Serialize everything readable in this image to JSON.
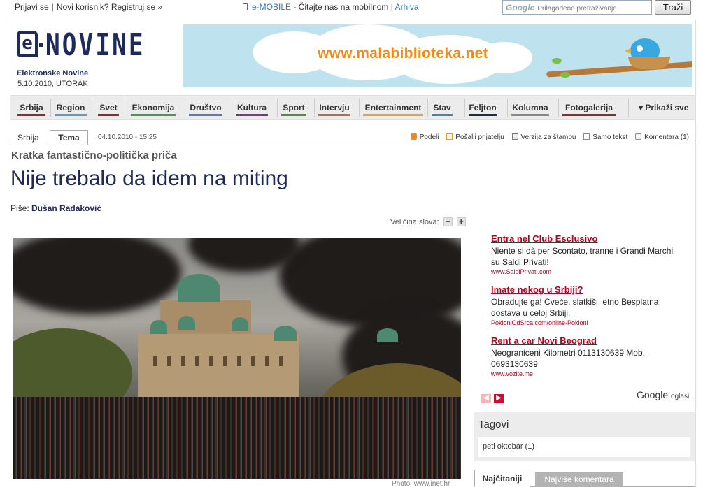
{
  "topbar": {
    "login": "Prijavi se",
    "sep": "|",
    "register": "Novi korisnik? Registruj se »",
    "emobile": "e-MOBILE",
    "emobile_text": " - Čitajte nas na mobilnom | ",
    "archive": "Arhiva",
    "search_logo": "Google",
    "search_placeholder": "Prilagođeno pretraživanje",
    "search_button": "Traži"
  },
  "header": {
    "logo_e": "e",
    "logo_name": "NOVINE",
    "tagline": "Elektronske Novine",
    "date": "5.10.2010, UTORAK",
    "banner_url": "www.malabiblioteka.net"
  },
  "nav": {
    "items": [
      {
        "label": "Srbija",
        "color": "#c8102e"
      },
      {
        "label": "Region",
        "color": "#4a9fd8"
      },
      {
        "label": "Svet",
        "color": "#c8102e"
      },
      {
        "label": "Ekonomija",
        "color": "#3aa23a"
      },
      {
        "label": "Društvo",
        "color": "#4a7fc8"
      },
      {
        "label": "Kultura",
        "color": "#8a2a9a"
      },
      {
        "label": "Sport",
        "color": "#3a9a2a"
      },
      {
        "label": "Intervju",
        "color": "#d0603a"
      },
      {
        "label": "Entertainment",
        "color": "#f0a020"
      },
      {
        "label": "Stav",
        "color": "#2a8ad8"
      },
      {
        "label": "Feljton",
        "color": "#1e2a5a"
      },
      {
        "label": "Kolumna",
        "color": "#888888"
      },
      {
        "label": "Fotogalerija",
        "color": "#c8102e"
      }
    ],
    "more": "Prikaži sve"
  },
  "article": {
    "tab_section": "Srbija",
    "tab_active": "Tema",
    "date": "04.10.2010 - 15:25",
    "tools": {
      "share": "Podeli",
      "send": "Pošalji prijatelju",
      "print": "Verzija za štampu",
      "text_only": "Samo tekst",
      "comments": "Komentara (1)"
    },
    "supertitle": "Kratka fantastično-politička priča",
    "title": "Nije trebalo da idem na miting",
    "author_label": "Piše: ",
    "author": "Dušan Radaković",
    "font_size_label": "Veličina slova:",
    "font_minus": "−",
    "font_plus": "+",
    "photo_caption": "Photo: www.inet.hr"
  },
  "ads": [
    {
      "title": "Entra nel Club Esclusivo",
      "body": "Niente si dà per Scontato, tranne i Grandi Marchi su Saldi Privati!",
      "url": "www.SaldiPrivati.com"
    },
    {
      "title": "Imate nekog u Srbiji?",
      "body": "Obradujte ga! Cveće, slatkiši, etno Besplatna dostava u celoj Srbiji.",
      "url": "PokloniOdSrca.com/online-Pokloni"
    },
    {
      "title": "Rent a car Novi Beograd",
      "body": "Neograniceni Kilometri 0113130639 Mob. 0693130639",
      "url": "www.vozite.me"
    }
  ],
  "ads_footer": {
    "google": "Google",
    "label": "oglasi"
  },
  "tags": {
    "title": "Tagovi",
    "items": [
      "peti oktobar (1)"
    ]
  },
  "bottom_tabs": {
    "active": "Najčitaniji",
    "other": "Najviše komentara"
  }
}
